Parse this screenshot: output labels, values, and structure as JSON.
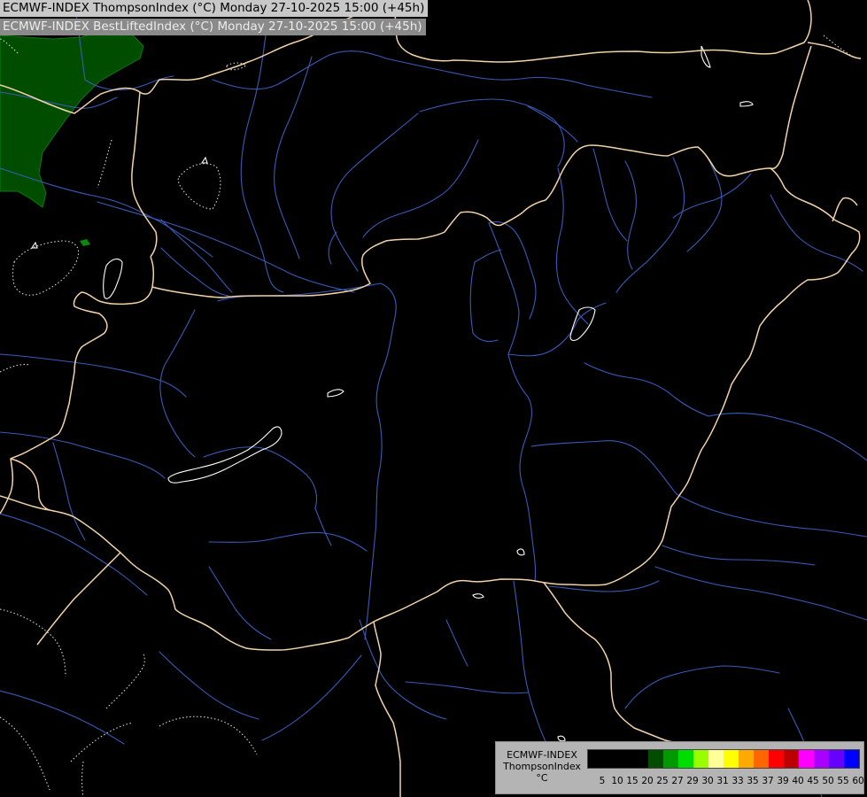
{
  "header": {
    "line1": "ECMWF-INDEX ThompsonIndex (°C) Monday 27-10-2025 15:00 (+45h)",
    "line2": "ECMWF-INDEX BestLiftedIndex (°C) Monday 27-10-2025 15:00 (+45h)"
  },
  "legend": {
    "title_line1": "ECMWF-INDEX",
    "title_line2": "ThompsonIndex",
    "title_line3": "°C",
    "colors": [
      "#000000",
      "#000000",
      "#000000",
      "#000000",
      "#004d00",
      "#009900",
      "#00dd00",
      "#99ff00",
      "#ffff99",
      "#ffff00",
      "#ffaa00",
      "#ff6600",
      "#ff0000",
      "#bb0000",
      "#ff00ff",
      "#aa00ff",
      "#6600ff",
      "#0000ff"
    ],
    "ticks": [
      "5",
      "10",
      "15",
      "20",
      "25",
      "27",
      "29",
      "30",
      "31",
      "33",
      "35",
      "37",
      "39",
      "40",
      "45",
      "50",
      "55",
      "60"
    ]
  },
  "map": {
    "colors": {
      "background": "#000000",
      "border": "#f2d3a8",
      "river": "#3a5ab8",
      "contour": "#ffffff",
      "green_area": "#004d00"
    }
  }
}
